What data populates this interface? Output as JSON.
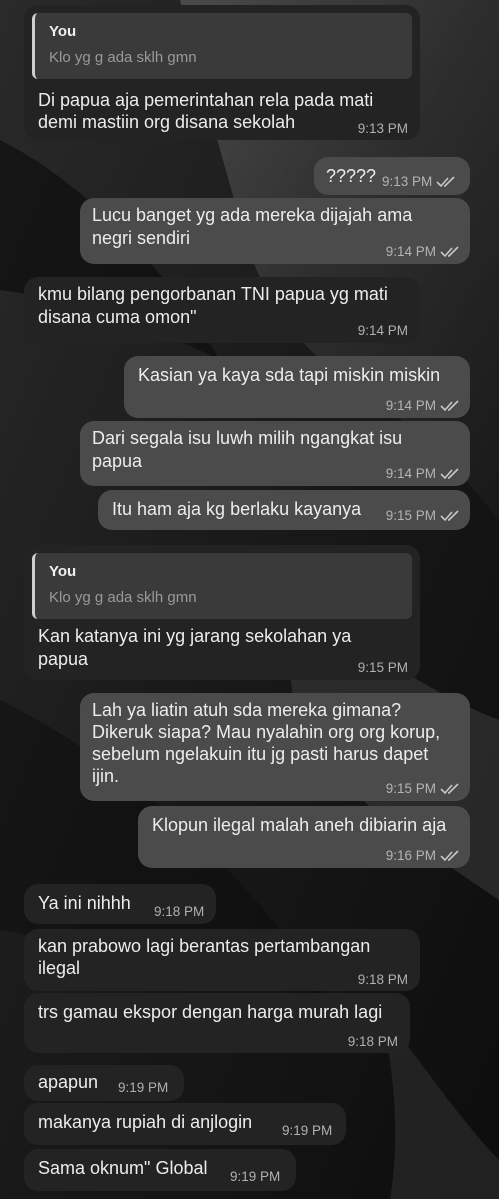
{
  "messages": [
    {
      "reply_name": "You",
      "reply_text": "Klo yg g ada sklh gmn",
      "lines": [
        "Di papua aja pemerintahan rela pada mati",
        "demi mastiin org disana sekolah"
      ],
      "time": "9:13 PM"
    },
    {
      "lines": [
        "?????"
      ],
      "time": "9:13 PM"
    },
    {
      "lines": [
        "Lucu banget yg ada mereka dijajah ama",
        "negri sendiri"
      ],
      "time": "9:14 PM"
    },
    {
      "lines": [
        "kmu bilang pengorbanan TNI papua yg mati",
        "disana cuma omon\""
      ],
      "time": "9:14 PM"
    },
    {
      "lines": [
        "Kasian ya kaya sda tapi miskin miskin"
      ],
      "time": "9:14 PM"
    },
    {
      "lines": [
        "Dari segala isu luwh milih ngangkat isu",
        "papua"
      ],
      "time": "9:14 PM"
    },
    {
      "lines": [
        "Itu ham aja kg berlaku kayanya"
      ],
      "time": "9:15 PM"
    },
    {
      "reply_name": "You",
      "reply_text": "Klo yg g ada sklh gmn",
      "lines": [
        "Kan katanya ini yg jarang sekolahan ya",
        "papua"
      ],
      "time": "9:15 PM"
    },
    {
      "lines": [
        "Lah ya liatin atuh sda mereka gimana?",
        "Dikeruk siapa? Mau nyalahin org org korup,",
        "sebelum ngelakuin itu jg pasti harus dapet",
        "ijin."
      ],
      "time": "9:15 PM"
    },
    {
      "lines": [
        "Klopun ilegal malah aneh dibiarin aja"
      ],
      "time": "9:16 PM"
    },
    {
      "lines": [
        "Ya ini nihhh"
      ],
      "time": "9:18 PM"
    },
    {
      "lines": [
        "kan prabowo lagi berantas pertambangan",
        "ilegal"
      ],
      "time": "9:18 PM"
    },
    {
      "lines": [
        "trs gamau ekspor dengan harga murah lagi"
      ],
      "time": "9:18 PM"
    },
    {
      "lines": [
        "apapun"
      ],
      "time": "9:19 PM"
    },
    {
      "lines": [
        "makanya rupiah di anjlogin"
      ],
      "time": "9:19 PM"
    },
    {
      "lines": [
        "Sama oknum\" Global"
      ],
      "time": "9:19 PM"
    }
  ],
  "colors": {
    "incoming": "#232323",
    "outgoing": "#4b4b4b",
    "read_check": "#c8c8c8"
  }
}
